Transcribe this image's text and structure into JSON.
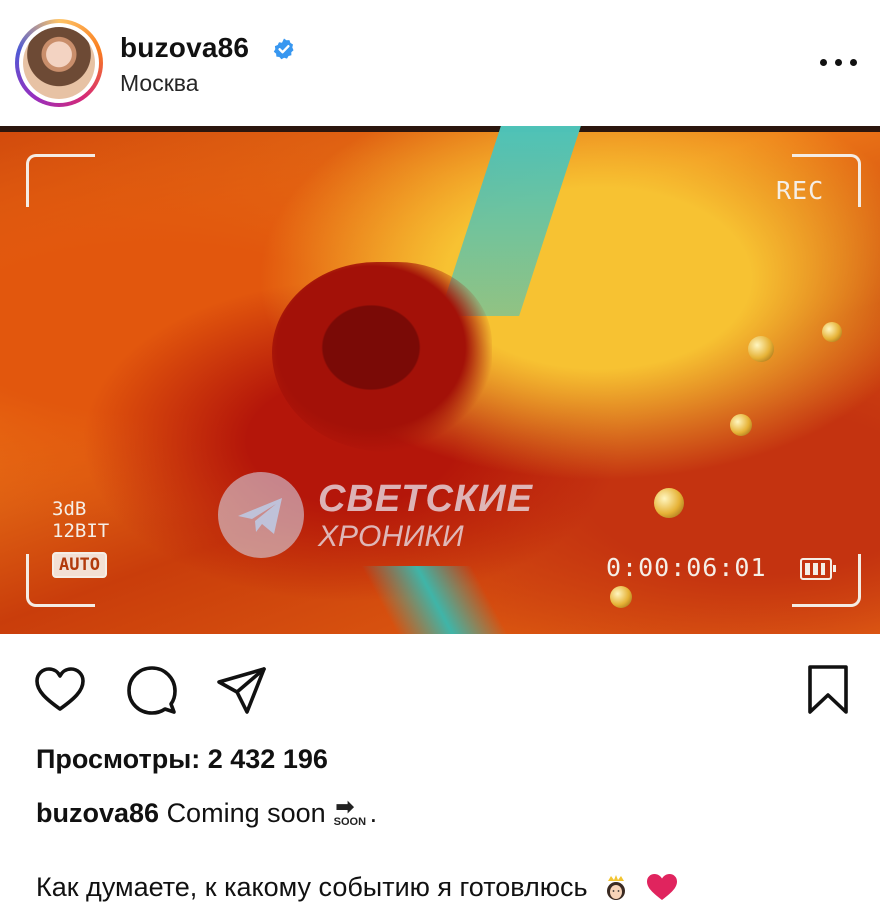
{
  "post_header": {
    "username": "buzova86",
    "location": "Москва",
    "verified": true,
    "more_icon": "more-horizontal-icon"
  },
  "media": {
    "rec_label": "REC",
    "db_label": "3dB",
    "bit_label": "12BIT",
    "auto_label": "AUTO",
    "timecode": "0:00:06:01",
    "watermark_line1": "СВЕТСКИЕ",
    "watermark_line2": "ХРОНИКИ",
    "colors": {
      "primary": "#e86a14",
      "accent": "#f7c232",
      "teal": "#4ec3b8"
    }
  },
  "actions": {
    "like_icon": "heart-icon",
    "comment_icon": "comment-icon",
    "share_icon": "send-icon",
    "save_icon": "bookmark-icon"
  },
  "stats": {
    "views_text": "Просмотры: 2 432 196"
  },
  "caption": {
    "username": "buzova86",
    "text": "Coming soon",
    "soon_label": "SOON",
    "trailing": ".",
    "question": "Как думаете, к какому  событию я готовлюсь"
  },
  "colors": {
    "verified_blue": "#3897f0",
    "heart_red": "#e0245e"
  }
}
